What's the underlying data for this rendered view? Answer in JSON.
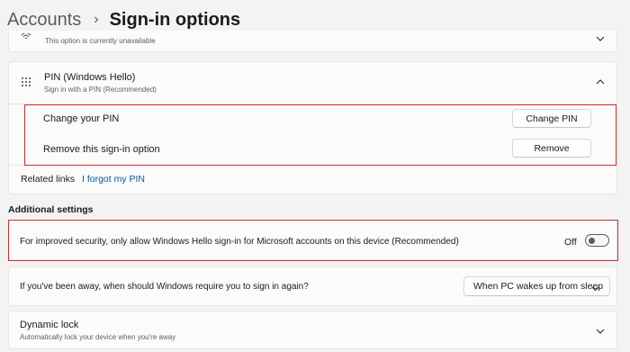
{
  "breadcrumb": {
    "parent": "Accounts",
    "separator": "›",
    "current": "Sign-in options"
  },
  "fingerprint": {
    "subtitle": "This option is currently unavailable"
  },
  "pin": {
    "title": "PIN (Windows Hello)",
    "subtitle": "Sign in with a PIN (Recommended)",
    "change_label": "Change your PIN",
    "change_button": "Change PIN",
    "remove_label": "Remove this sign-in option",
    "remove_button": "Remove",
    "related_label": "Related links",
    "forgot_link": "I forgot my PIN"
  },
  "additional": {
    "heading": "Additional settings",
    "hello_only_text": "For improved security, only allow Windows Hello sign-in for Microsoft accounts on this device (Recommended)",
    "hello_only_state": "Off",
    "hello_only_on": false,
    "away_text": "If you've been away, when should Windows require you to sign in again?",
    "away_selected": "When PC wakes up from sleep",
    "dynamic_title": "Dynamic lock",
    "dynamic_subtitle": "Automatically lock your device when you're away"
  },
  "colors": {
    "link": "#005a9e",
    "highlight": "#d22f2f",
    "background": "#f3f3f3"
  },
  "icons": [
    "fingerprint-icon",
    "pin-keypad-icon",
    "chevron-down-icon",
    "chevron-up-icon"
  ]
}
